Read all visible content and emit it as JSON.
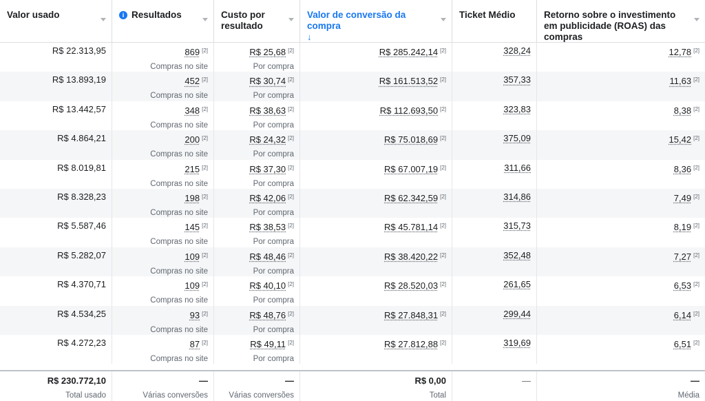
{
  "columns": [
    {
      "label": "Valor usado"
    },
    {
      "label": "Resultados"
    },
    {
      "label": "Custo por resultado"
    },
    {
      "label": "Valor de conversão da compra",
      "sort_arrow": "↓"
    },
    {
      "label": "Ticket Médio"
    },
    {
      "label": "Retorno sobre o investimento em publicidade (ROAS) das compras"
    }
  ],
  "colors": {
    "accent": "#1877f2",
    "alt_row": "#f5f6f7"
  },
  "note_marker": "[2]",
  "result_type": "Compras no site",
  "cost_type": "Por compra",
  "rows": [
    {
      "spend": "R$ 22.313,95",
      "results": "869",
      "cpr": "R$ 25,68",
      "conv_value": "R$ 285.242,14",
      "ticket": "328,24",
      "roas": "12,78"
    },
    {
      "spend": "R$ 13.893,19",
      "results": "452",
      "cpr": "R$ 30,74",
      "conv_value": "R$ 161.513,52",
      "ticket": "357,33",
      "roas": "11,63"
    },
    {
      "spend": "R$ 13.442,57",
      "results": "348",
      "cpr": "R$ 38,63",
      "conv_value": "R$ 112.693,50",
      "ticket": "323,83",
      "roas": "8,38"
    },
    {
      "spend": "R$ 4.864,21",
      "results": "200",
      "cpr": "R$ 24,32",
      "conv_value": "R$ 75.018,69",
      "ticket": "375,09",
      "roas": "15,42"
    },
    {
      "spend": "R$ 8.019,81",
      "results": "215",
      "cpr": "R$ 37,30",
      "conv_value": "R$ 67.007,19",
      "ticket": "311,66",
      "roas": "8,36"
    },
    {
      "spend": "R$ 8.328,23",
      "results": "198",
      "cpr": "R$ 42,06",
      "conv_value": "R$ 62.342,59",
      "ticket": "314,86",
      "roas": "7,49"
    },
    {
      "spend": "R$ 5.587,46",
      "results": "145",
      "cpr": "R$ 38,53",
      "conv_value": "R$ 45.781,14",
      "ticket": "315,73",
      "roas": "8,19"
    },
    {
      "spend": "R$ 5.282,07",
      "results": "109",
      "cpr": "R$ 48,46",
      "conv_value": "R$ 38.420,22",
      "ticket": "352,48",
      "roas": "7,27"
    },
    {
      "spend": "R$ 4.370,71",
      "results": "109",
      "cpr": "R$ 40,10",
      "conv_value": "R$ 28.520,03",
      "ticket": "261,65",
      "roas": "6,53"
    },
    {
      "spend": "R$ 4.534,25",
      "results": "93",
      "cpr": "R$ 48,76",
      "conv_value": "R$ 27.848,31",
      "ticket": "299,44",
      "roas": "6,14"
    },
    {
      "spend": "R$ 4.272,23",
      "results": "87",
      "cpr": "R$ 49,11",
      "conv_value": "R$ 27.812,88",
      "ticket": "319,69",
      "roas": "6,51"
    }
  ],
  "footer": {
    "spend": "R$ 230.772,10",
    "spend_sub": "Total usado",
    "results": "—",
    "results_sub": "Várias conversões",
    "cpr": "—",
    "cpr_sub": "Várias conversões",
    "conv_value": "R$ 0,00",
    "conv_value_sub": "Total",
    "ticket": "—",
    "roas": "—",
    "roas_sub": "Média"
  }
}
